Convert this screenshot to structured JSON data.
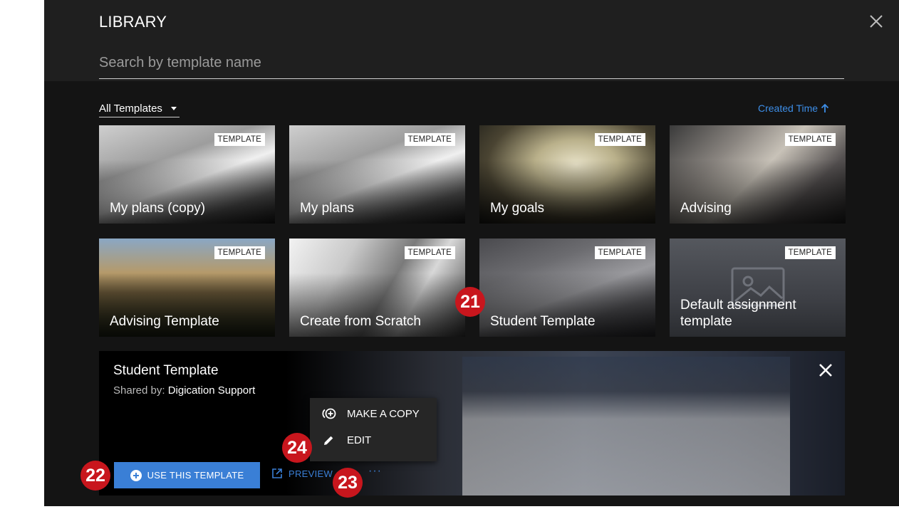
{
  "header": {
    "title": "LIBRARY",
    "search_placeholder": "Search by template name"
  },
  "filter": {
    "label": "All Templates"
  },
  "sort": {
    "label": "Created Time"
  },
  "badge_label": "TEMPLATE",
  "cards": [
    {
      "name": "My plans (copy)"
    },
    {
      "name": "My plans"
    },
    {
      "name": "My goals"
    },
    {
      "name": "Advising"
    },
    {
      "name": "Advising Template"
    },
    {
      "name": "Create from Scratch"
    },
    {
      "name": "Student Template",
      "selected": true
    },
    {
      "name": "Default assignment template"
    }
  ],
  "detail": {
    "title": "Student Template",
    "shared_label": "Shared by:",
    "shared_by": "Digication Support",
    "use_button": "USE THIS TEMPLATE",
    "preview_button": "PREVIEW",
    "more_button": "···",
    "menu": {
      "make_copy": "MAKE A COPY",
      "edit": "EDIT"
    }
  },
  "markers": [
    "21",
    "22",
    "23",
    "24"
  ],
  "colors": {
    "accent": "#3a7fd6",
    "marker": "#c8161d"
  },
  "icons": [
    "close-icon",
    "caret-down-icon",
    "arrow-up-icon",
    "plus-circle-icon",
    "external-link-icon",
    "copy-plus-icon",
    "pencil-icon"
  ]
}
